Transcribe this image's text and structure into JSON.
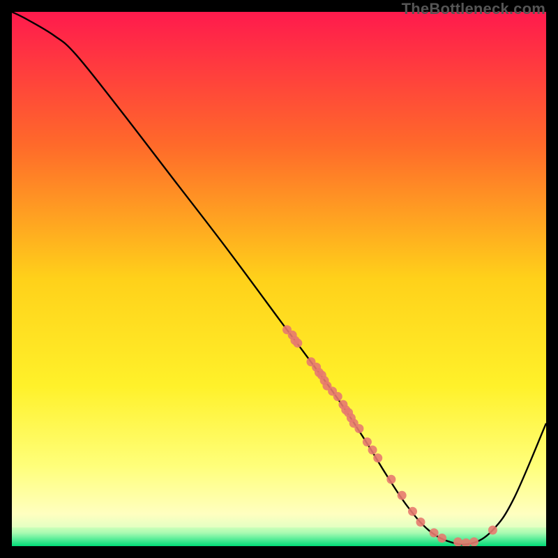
{
  "watermark": "TheBottleneck.com",
  "chart_data": {
    "type": "line",
    "title": "",
    "xlabel": "",
    "ylabel": "",
    "xlim": [
      0,
      100
    ],
    "ylim": [
      0,
      100
    ],
    "grid": false,
    "legend": false,
    "background_gradient": {
      "stops": [
        {
          "offset": 0.0,
          "color": "#ff1a4d"
        },
        {
          "offset": 0.25,
          "color": "#ff6a2a"
        },
        {
          "offset": 0.5,
          "color": "#ffd11a"
        },
        {
          "offset": 0.7,
          "color": "#fff12a"
        },
        {
          "offset": 0.85,
          "color": "#ffff7a"
        },
        {
          "offset": 0.94,
          "color": "#ffffc0"
        },
        {
          "offset": 0.975,
          "color": "#d8ffc4"
        },
        {
          "offset": 1.0,
          "color": "#00e07a"
        }
      ]
    },
    "curve": {
      "x": [
        0,
        3,
        8,
        12,
        20,
        30,
        40,
        50,
        60,
        66,
        70,
        74,
        78,
        82,
        86,
        90,
        94,
        100
      ],
      "y": [
        100,
        98.5,
        95.5,
        92,
        82,
        69,
        56,
        42.5,
        29,
        20,
        13.5,
        7.5,
        3,
        0.8,
        0.5,
        3,
        9,
        23
      ]
    },
    "scatter": {
      "x": [
        51.5,
        52.5,
        53.0,
        53.5,
        56.0,
        57.0,
        57.5,
        58.0,
        58.5,
        59.0,
        60.0,
        61.0,
        62.0,
        62.5,
        63.0,
        63.5,
        64.0,
        65.0,
        66.5,
        67.5,
        68.5,
        71.0,
        73.0,
        75.0,
        76.5,
        79.0,
        80.5,
        83.5,
        85.0,
        86.5,
        90.0
      ],
      "y": [
        40.5,
        39.5,
        38.5,
        38.0,
        34.5,
        33.5,
        32.5,
        32.0,
        31.0,
        30.0,
        29.0,
        28.0,
        26.5,
        25.5,
        25.0,
        24.0,
        23.0,
        22.0,
        19.5,
        18.0,
        16.5,
        12.5,
        9.5,
        6.5,
        4.5,
        2.5,
        1.5,
        0.8,
        0.6,
        0.8,
        3.0
      ]
    },
    "green_band": {
      "y_min": 0,
      "y_max": 3.5
    }
  }
}
